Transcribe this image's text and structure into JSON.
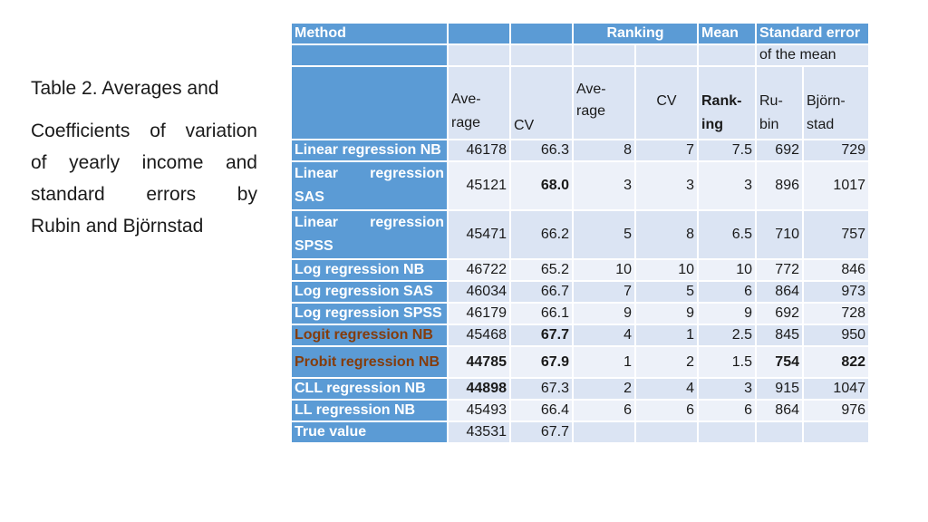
{
  "caption": {
    "lines": [
      "Table 2. Averages and",
      "Coefficients of variation",
      "of yearly income and",
      "standard errors by",
      "Rubin and Björnstad"
    ]
  },
  "table": {
    "header": {
      "method": "Method",
      "ranking": "Ranking",
      "mean": "Mean",
      "std_error": "Standard error",
      "std_error_sub": "of the mean",
      "average_a": "Ave-",
      "average_b": "rage",
      "cv": "CV",
      "rank_average_a": "Ave-",
      "rank_average_b": "rage",
      "rank_cv": "CV",
      "rank_mean_a": "Rank-",
      "rank_mean_b": "ing",
      "rubin_a": "Ru-",
      "rubin_b": "bin",
      "bjornstad_a": "Björn-",
      "bjornstad_b": "stad"
    },
    "rows": [
      {
        "method": "Linear regression NB",
        "average": "46178",
        "cv": "66.3",
        "rank_avg": "8",
        "rank_cv": "7",
        "rank_mean": "7.5",
        "rubin": "692",
        "bjornstad": "729"
      },
      {
        "method": "Linear regression SAS",
        "average": "45121",
        "cv": "68.0",
        "rank_avg": "3",
        "rank_cv": "3",
        "rank_mean": "3",
        "rubin": "896",
        "bjornstad": "1017"
      },
      {
        "method": "Linear regression SPSS",
        "average": "45471",
        "cv": "66.2",
        "rank_avg": "5",
        "rank_cv": "8",
        "rank_mean": "6.5",
        "rubin": "710",
        "bjornstad": "757"
      },
      {
        "method": "Log regression NB",
        "average": "46722",
        "cv": "65.2",
        "rank_avg": "10",
        "rank_cv": "10",
        "rank_mean": "10",
        "rubin": "772",
        "bjornstad": "846"
      },
      {
        "method": "Log regression SAS",
        "average": "46034",
        "cv": "66.7",
        "rank_avg": "7",
        "rank_cv": "5",
        "rank_mean": "6",
        "rubin": "864",
        "bjornstad": "973"
      },
      {
        "method": "Log regression SPSS",
        "average": "46179",
        "cv": "66.1",
        "rank_avg": "9",
        "rank_cv": "9",
        "rank_mean": "9",
        "rubin": "692",
        "bjornstad": "728"
      },
      {
        "method": "Logit regression NB",
        "average": "45468",
        "cv": "67.7",
        "rank_avg": "4",
        "rank_cv": "1",
        "rank_mean": "2.5",
        "rubin": "845",
        "bjornstad": "950"
      },
      {
        "method": "Probit regression NB",
        "average": "44785",
        "cv": "67.9",
        "rank_avg": "1",
        "rank_cv": "2",
        "rank_mean": "1.5",
        "rubin": "754",
        "bjornstad": "822"
      },
      {
        "method": "CLL regression NB",
        "average": "44898",
        "cv": "67.3",
        "rank_avg": "2",
        "rank_cv": "4",
        "rank_mean": "3",
        "rubin": "915",
        "bjornstad": "1047"
      },
      {
        "method": "LL regression NB",
        "average": "45493",
        "cv": "66.4",
        "rank_avg": "6",
        "rank_cv": "6",
        "rank_mean": "6",
        "rubin": "864",
        "bjornstad": "976"
      },
      {
        "method": "True value",
        "average": "43531",
        "cv": "67.7",
        "rank_avg": "",
        "rank_cv": "",
        "rank_mean": "",
        "rubin": "",
        "bjornstad": ""
      }
    ]
  },
  "colors": {
    "header_blue": "#5b9bd5",
    "cell_light": "#dbe4f3",
    "cell_lighter": "#edf1f9",
    "highlight_brown": "#843c0c"
  }
}
